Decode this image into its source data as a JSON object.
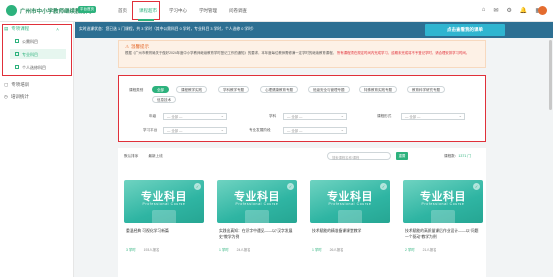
{
  "header": {
    "logo_text": "广州市中小学教师继续教育网",
    "logo_tag": "平台首页",
    "nav": [
      "首页",
      "课程超市",
      "学习中心",
      "学时管理",
      "问卷调查"
    ],
    "active_nav": "课程超市"
  },
  "sidebar": {
    "group_title": "专项课程",
    "items": [
      "公需科目",
      "专业科目",
      "个人选修科目"
    ],
    "active_item": "专业科目",
    "other": [
      "专项培训",
      "培训统计"
    ]
  },
  "banner": {
    "text": "实时选课状态：您已选 1 门课程，共 3 学时（其中公需科目 0 学时，专业科目 3 学时，个人选修 0 学时）",
    "button": "点击查看我的课单"
  },
  "notice": {
    "title": "温馨提示",
    "body": "根据《广州市教育局关于做好2024年度中小学教师继续教育学时登记工作的通知》的要求，本年度每位教师需修满一定学时的继续教育课程。",
    "warning": "所有课程须在规定时间内完成学习，逾期未完成将不予登记学时，请合理安排学习时间。"
  },
  "filter": {
    "type_label": "课程类别",
    "chips": [
      "全部",
      "课程教学实践",
      "学科教学专题",
      "心理健康教育专题",
      "班级安全与管理专题",
      "特殊教育实践专题",
      "教育科学研究专题",
      "信息技术"
    ],
    "active_chip": "全部",
    "fields": [
      {
        "label": "年级",
        "value": "— 全部 —"
      },
      {
        "label": "学科",
        "value": "— 全部 —"
      },
      {
        "label": "课程形式",
        "value": "— 全部 —"
      },
      {
        "label": "学习平台",
        "value": "— 全部 —"
      },
      {
        "label": "专业发展阶段",
        "value": "— 全部 —"
      }
    ]
  },
  "list": {
    "sort_default": "默认排序",
    "sort_latest": "最新上线",
    "search_placeholder": "搜索课程名称/课程",
    "reset": "重置",
    "count_label": "课程数：",
    "count_value": "1371 门",
    "cards": [
      {
        "cover_title": "专业科目",
        "cover_sub": "Professional Course",
        "name": "重温经典 可视化学习新篇",
        "hours": "3 学时",
        "enrolled": "193人报名"
      },
      {
        "cover_title": "专业科目",
        "cover_sub": "Professional Course",
        "name": "实践出真知：在识字中遇见——以“汉字发展史”教学为例",
        "hours": "1 学时",
        "enrolled": "24人报名"
      },
      {
        "cover_title": "专业科目",
        "cover_sub": "Professional Course",
        "name": "技术赋能的精准备课课堂教学",
        "hours": "1 学时",
        "enrolled": "26人报名"
      },
      {
        "cover_title": "专业科目",
        "cover_sub": "Professional Course",
        "name": "技术赋能的高质量课后作业设计——以“问题一个驱动”教学为例",
        "hours": "2 学时",
        "enrolled": "21人报名"
      }
    ]
  }
}
